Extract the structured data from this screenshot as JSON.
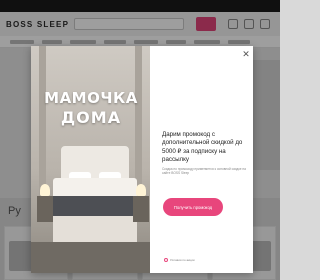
{
  "site": {
    "logo_text": "BOSS SLEEP",
    "topbar_text": "",
    "section_title": "Ру"
  },
  "modal": {
    "banner_line1": "МАМОЧКА",
    "banner_line2": "ДОМА",
    "close_label": "✕",
    "promo_text": "Дарим промокод с дополнительной скидкой до 5000 ₽ за подписку на рассылку",
    "promo_sub": "Скидка по промокоду применяется к основной скидке на сайте BOSS Sleep",
    "cta_label": "Получить промокод",
    "footer_link": "Условия по акции"
  },
  "colors": {
    "accent": "#e8467c",
    "topbar": "#1b1b1b",
    "overlay": "rgba(0,0,0,0.38)"
  },
  "icons": [
    "close-icon",
    "cart-icon",
    "user-icon",
    "info-icon"
  ]
}
